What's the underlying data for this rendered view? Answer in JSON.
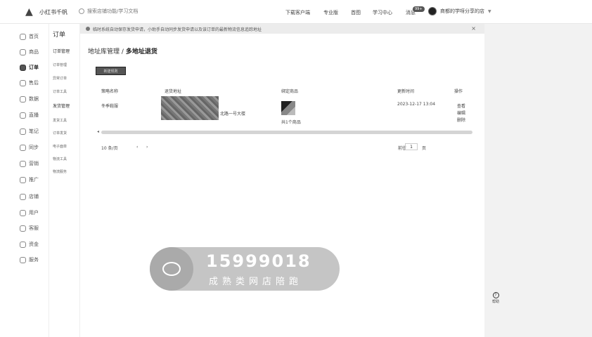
{
  "header": {
    "app_name": "小红书千帆",
    "search_placeholder": "搜索店铺功能/学习文档",
    "nav": [
      "下载客户端",
      "专业版",
      "首图",
      "学习中心",
      "消息"
    ],
    "message_badge": "99+",
    "shop_name": "商都的学呀分享的店"
  },
  "sidebar": {
    "items": [
      {
        "label": "首页",
        "icon": "home-icon"
      },
      {
        "label": "商品",
        "icon": "goods-icon"
      },
      {
        "label": "订单",
        "icon": "order-icon",
        "active": true
      },
      {
        "label": "售后",
        "icon": "after-sale-icon"
      },
      {
        "label": "数据",
        "icon": "data-icon"
      },
      {
        "label": "直播",
        "icon": "live-icon"
      },
      {
        "label": "笔记",
        "icon": "note-icon"
      },
      {
        "label": "同步",
        "icon": "sync-icon"
      },
      {
        "label": "营销",
        "icon": "marketing-icon"
      },
      {
        "label": "推广",
        "icon": "promote-icon"
      },
      {
        "label": "店铺",
        "icon": "shop-icon"
      },
      {
        "label": "用户",
        "icon": "user-icon"
      },
      {
        "label": "客服",
        "icon": "service-icon"
      },
      {
        "label": "资金",
        "icon": "fund-icon"
      },
      {
        "label": "服务",
        "icon": "grid-icon"
      }
    ]
  },
  "subnav": {
    "title": "订单",
    "group1": "订单管理",
    "group1_items": [
      "订单管理",
      "异常订单",
      "订单工具"
    ],
    "group2": "发货管理",
    "group2_items": [
      "发货工具",
      "订单发货",
      "电子面单",
      "物流工具",
      "物流服务"
    ]
  },
  "notice": {
    "text": "临时系统自动保存发货申请，小助手自动同步发货申请以及该订单的最新物流信息追踪地址"
  },
  "main": {
    "breadcrumb_parent": "地址库管理",
    "breadcrumb_sep": "/",
    "breadcrumb_current": "多地址退货",
    "add_button": "新建规则",
    "columns": [
      "策略名称",
      "退货地址",
      "绑定商品",
      "更新时间",
      "操作"
    ],
    "row": {
      "name": "冬季鞋服",
      "address_suffix": "北路一号大楼",
      "goods_link": "共1个商品",
      "updated": "2023-12-17 13:04",
      "actions": [
        "查看",
        "编辑",
        "删除"
      ]
    },
    "pager": {
      "page_size": "10 条/页",
      "page": "1",
      "goto_label": "前往",
      "page_suffix": "页"
    }
  },
  "watermark": {
    "number": "15999018",
    "subtitle": "成熟类网店陪跑"
  },
  "help": {
    "label": "帮助"
  }
}
